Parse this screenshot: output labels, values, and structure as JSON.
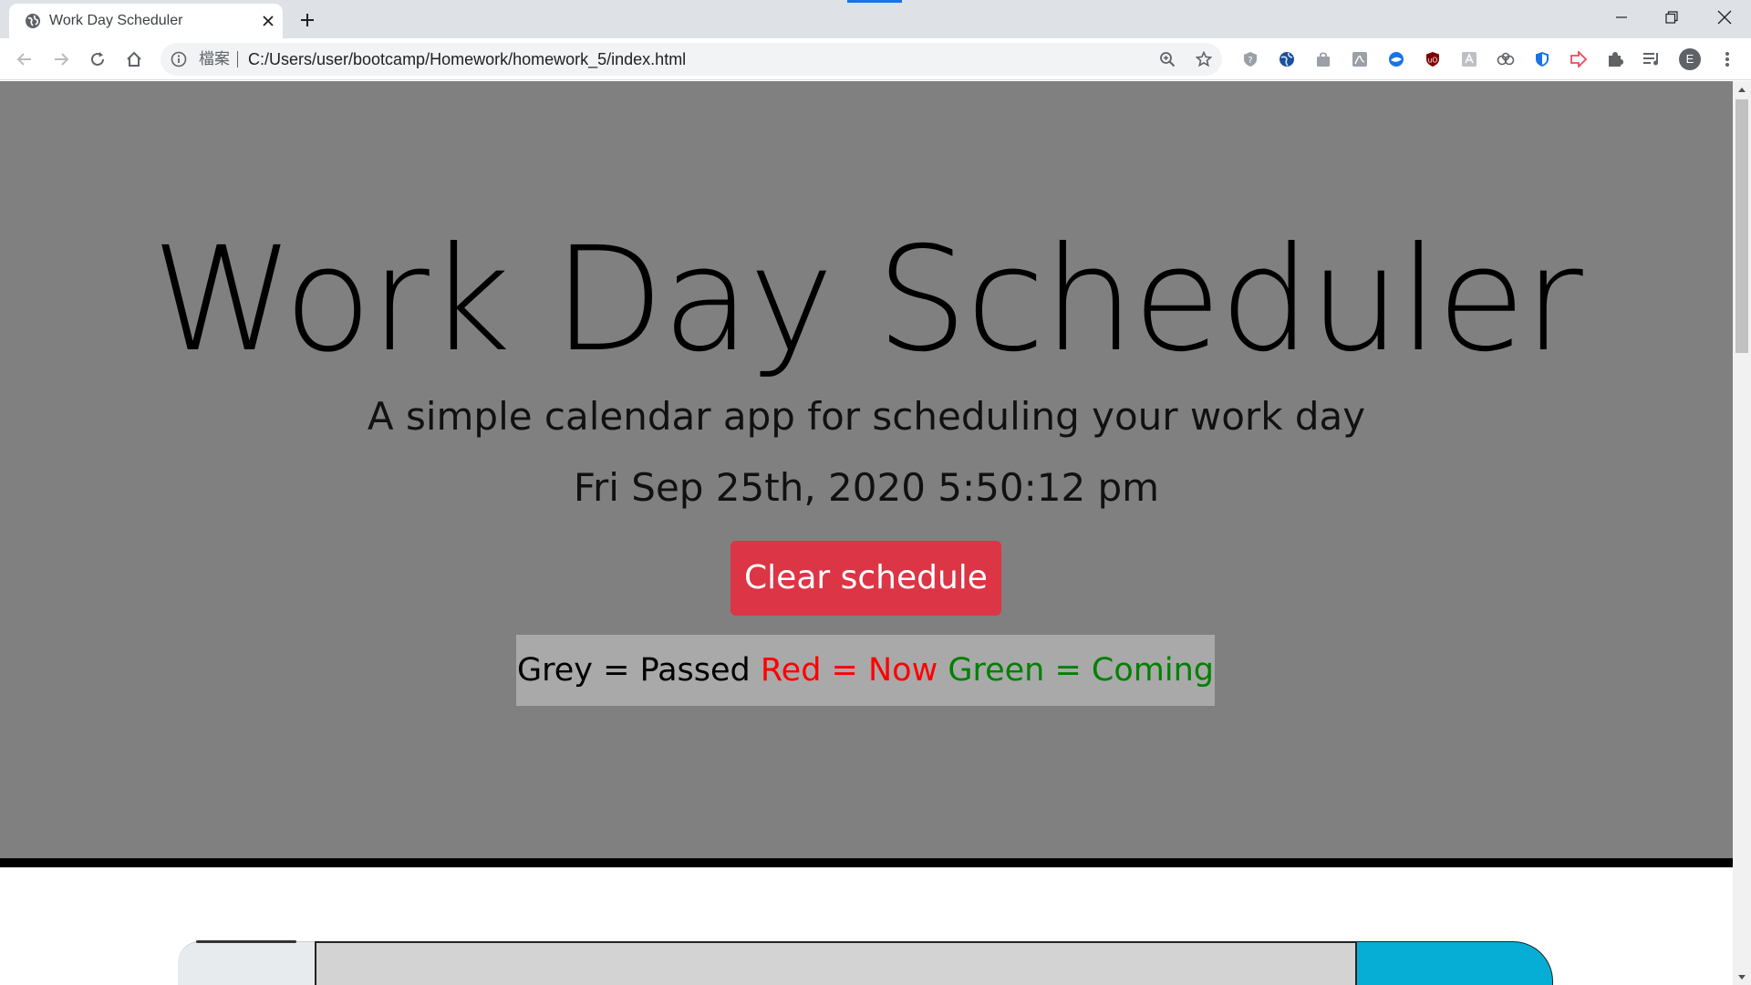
{
  "browser": {
    "tab": {
      "title": "Work Day Scheduler",
      "favicon": "globe-icon",
      "close_icon": "close-icon"
    },
    "new_tab_icon": "plus-icon",
    "window_controls": [
      "minimize-icon",
      "restore-icon",
      "close-icon"
    ],
    "toolbar": {
      "nav": [
        "back-arrow-icon",
        "forward-arrow-icon",
        "reload-icon",
        "home-icon"
      ],
      "omnibox": {
        "info_icon": "info-icon",
        "scheme_label": "檔案",
        "url": "C:/Users/user/bootcamp/Homework/homework_5/index.html",
        "zoom_icon": "zoom-icon",
        "bookmark_icon": "star-icon"
      },
      "extensions": [
        "help-extension-icon",
        "globe-extension-icon",
        "bag-extension-icon",
        "pdf-extension-icon",
        "blue-extension-icon",
        "ublock-icon",
        "grey-extension-icon",
        "cloud-extension-icon",
        "shield-extension-icon",
        "red-arrow-extension-icon",
        "puzzle-icon",
        "reading-list-icon"
      ],
      "avatar_letter": "E",
      "menu_icon": "kebab-menu-icon"
    }
  },
  "page": {
    "title": "Work Day Scheduler",
    "lead": "A simple calendar app for scheduling your work day",
    "current_day": "Fri Sep 25th, 2020 5:50:12 pm",
    "clear_button": "Clear schedule",
    "legend": {
      "grey": "Grey = Passed",
      "red": "Red = Now",
      "green": "Green = Coming"
    },
    "colors": {
      "jumbotron": "#808080",
      "clear_button": "#dc3545",
      "legend_background": "#a9a9a9",
      "red": "#ff0000",
      "green": "#008000",
      "past_block": "#d3d3d3",
      "save_button": "#06aed5"
    }
  }
}
